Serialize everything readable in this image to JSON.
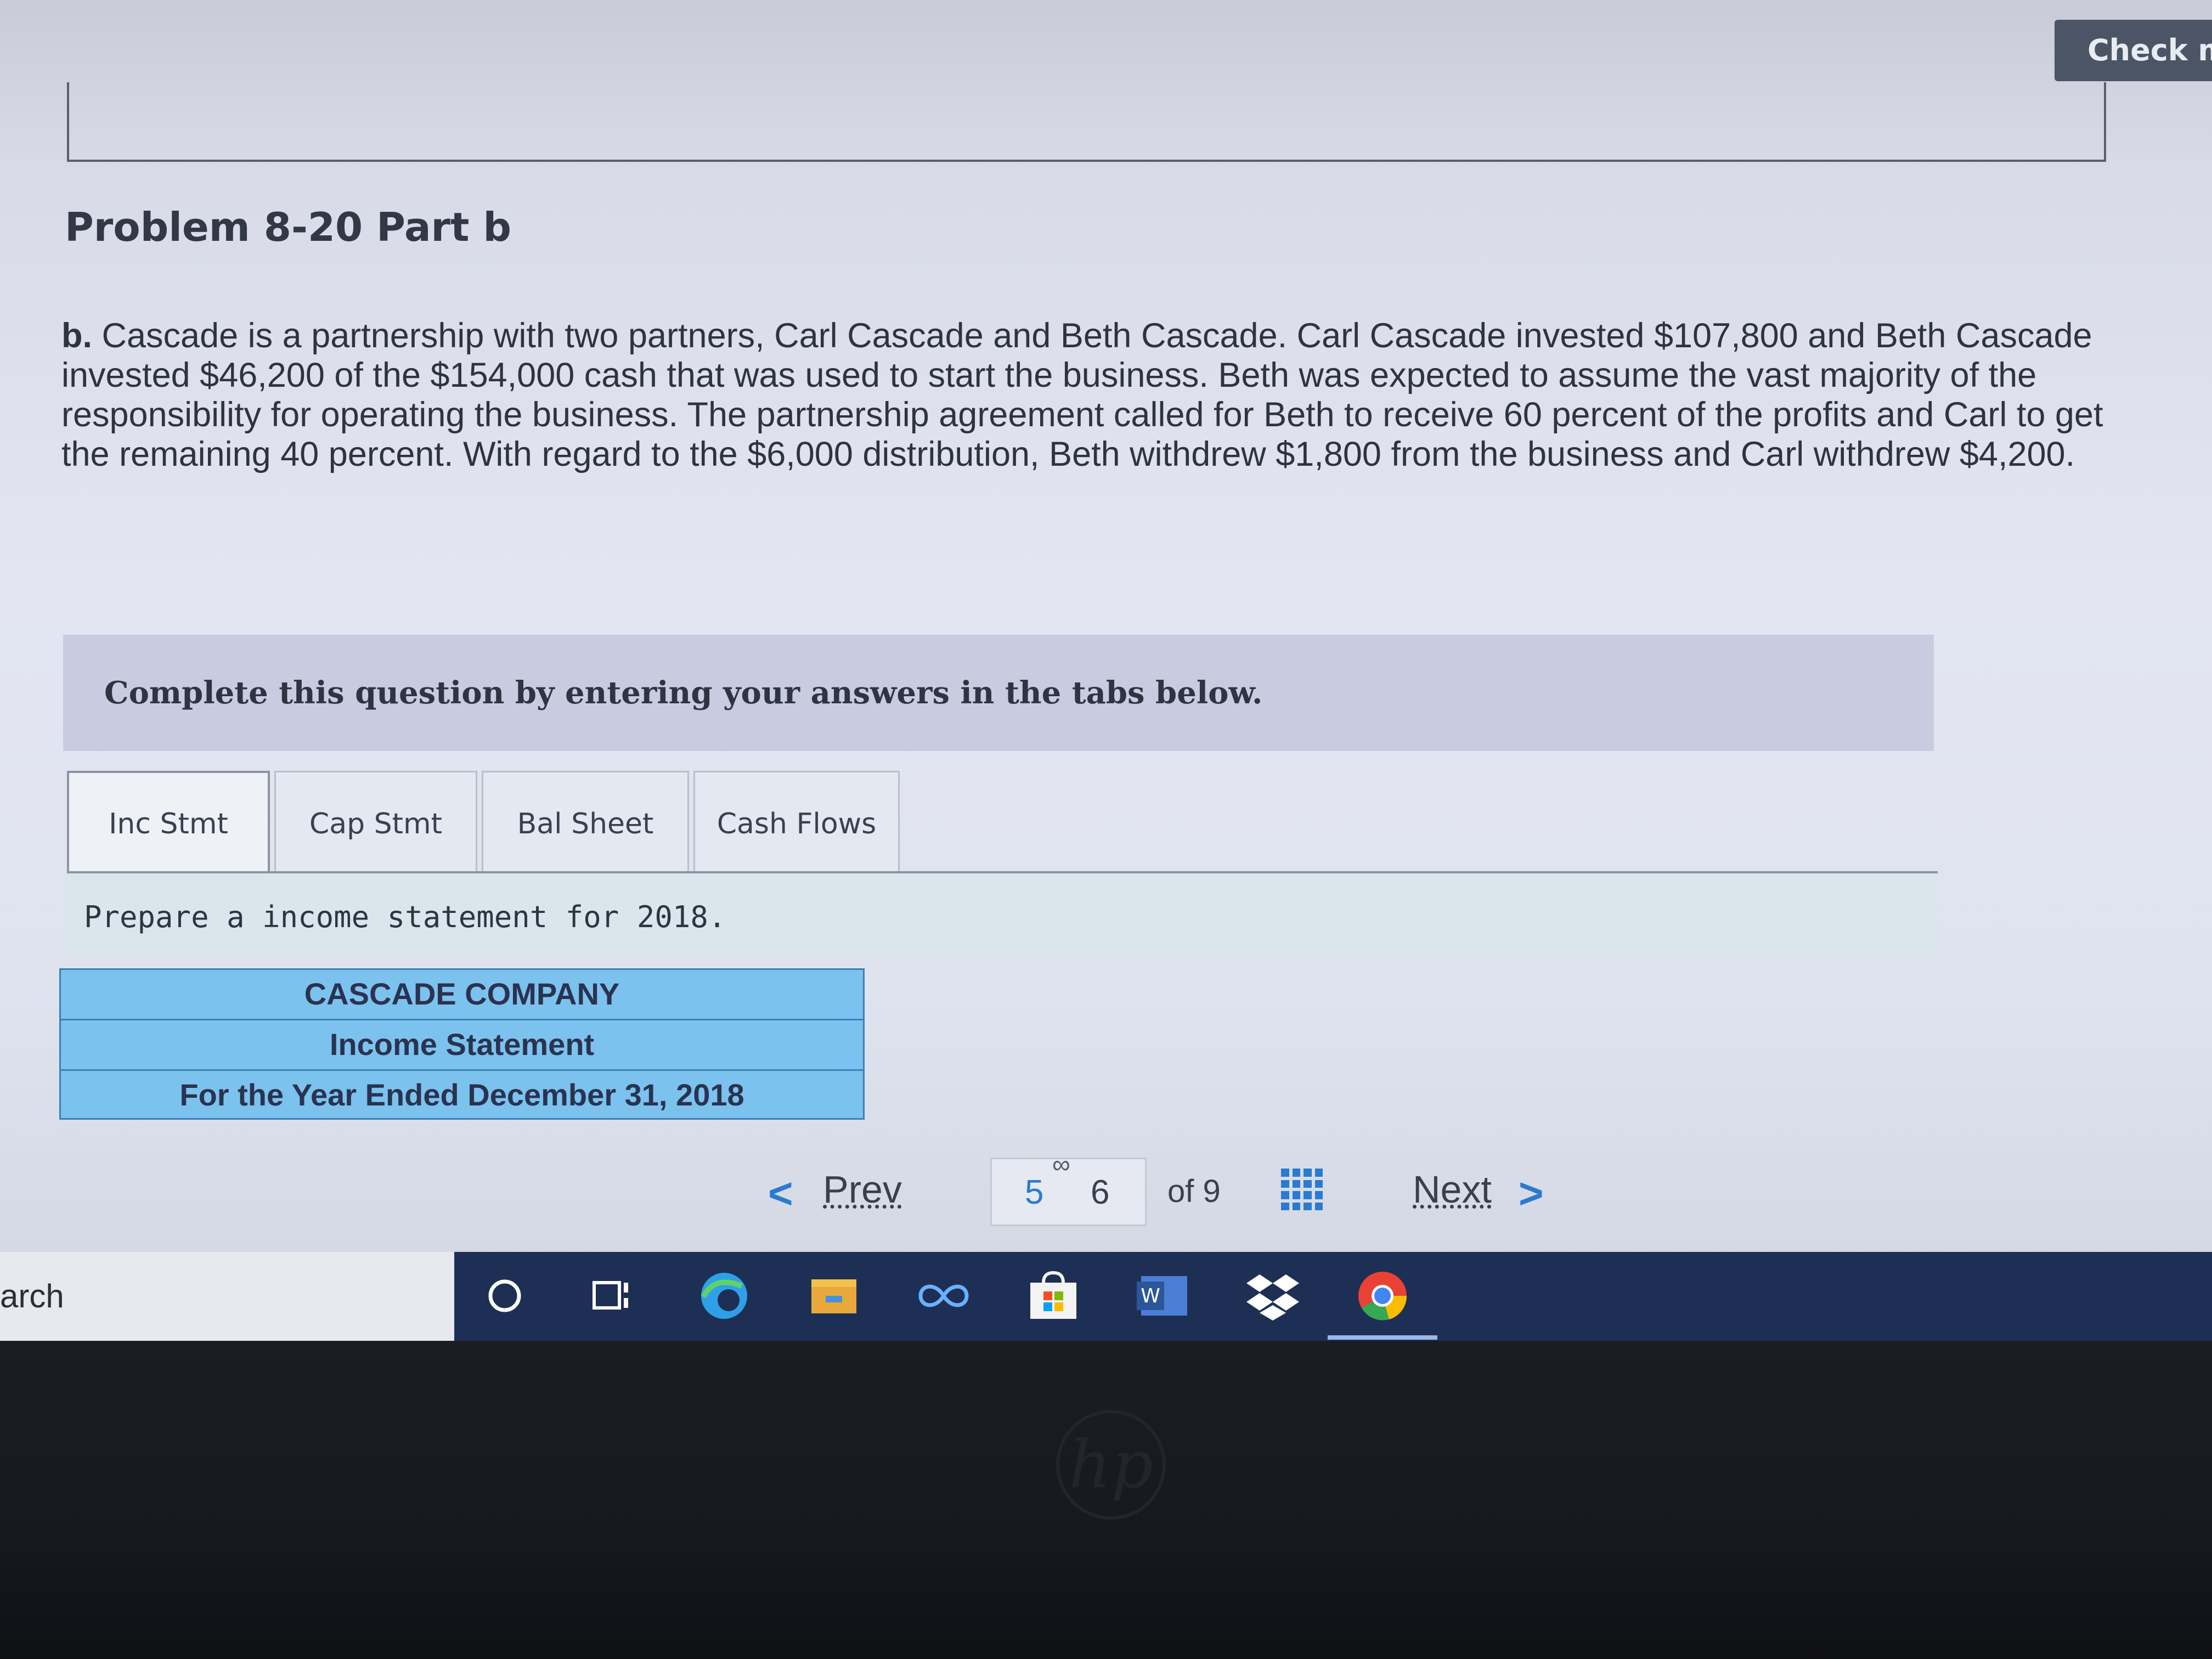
{
  "header": {
    "check_button_label": "Check my"
  },
  "problem": {
    "title": "Problem 8-20 Part b",
    "label": "b.",
    "text": "Cascade is a partnership with two partners, Carl Cascade and Beth Cascade. Carl Cascade invested $107,800 and Beth Cascade invested $46,200 of the $154,000 cash that was used to start the business. Beth was expected to assume the vast majority of the responsibility for operating the business. The partnership agreement called for Beth to receive 60 percent of the profits and Carl to get the remaining 40 percent. With regard to the $6,000 distribution, Beth withdrew $1,800 from the business and Carl withdrew $4,200."
  },
  "instructions": "Complete this question by entering your answers in the tabs below.",
  "tabs": [
    {
      "label": "Inc Stmt",
      "active": true
    },
    {
      "label": "Cap Stmt",
      "active": false
    },
    {
      "label": "Bal Sheet",
      "active": false
    },
    {
      "label": "Cash Flows",
      "active": false
    }
  ],
  "tab_prompt": "Prepare a income statement for 2018.",
  "statement": {
    "company": "CASCADE COMPANY",
    "name": "Income Statement",
    "period": "For the Year Ended December 31, 2018"
  },
  "pager": {
    "prev_label": "Prev",
    "pages": [
      "5",
      "6"
    ],
    "of_label": "of 9",
    "next_label": "Next"
  },
  "taskbar": {
    "search_text": "arch",
    "icons": [
      "cortana-circle-icon",
      "task-view-icon",
      "edge-icon",
      "file-explorer-icon",
      "infinity-app-icon",
      "store-icon",
      "word-icon",
      "dropbox-icon",
      "chrome-icon"
    ]
  },
  "colors": {
    "statement_header_bg": "#7cc2ee",
    "accent_blue": "#2a7ad0",
    "taskbar_bg": "#1e2f55"
  }
}
